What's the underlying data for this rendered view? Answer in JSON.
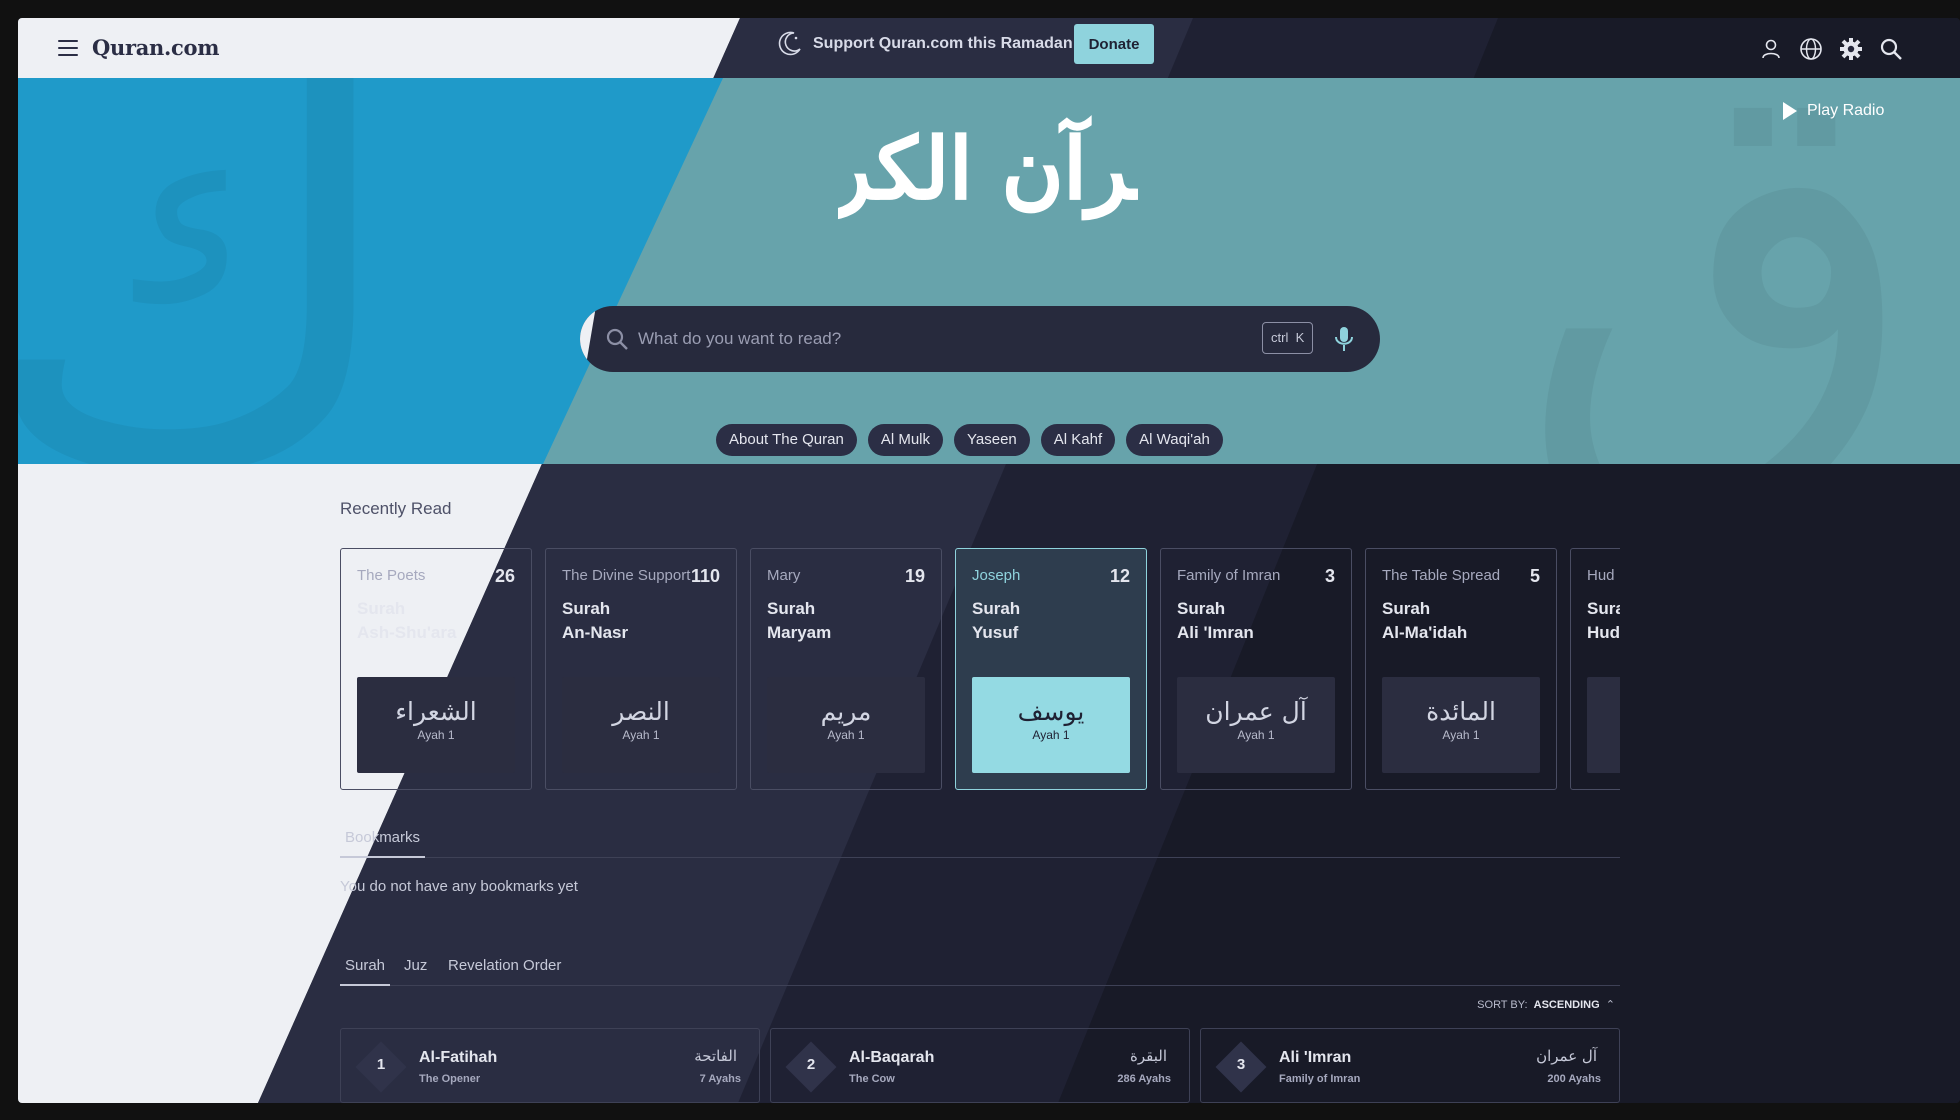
{
  "header": {
    "logo": "Quran.com",
    "support_text": "Support Quran.com this Ramadan",
    "donate_label": "Donate"
  },
  "hero": {
    "play_radio": "Play Radio",
    "calligraphy": "القرآن الكريم",
    "search": {
      "placeholder": "What do you want to read?",
      "shortcut_ctrl": "ctrl",
      "shortcut_key": "K"
    },
    "chips": [
      "About The Quran",
      "Al Mulk",
      "Yaseen",
      "Al Kahf",
      "Al Waqi'ah"
    ]
  },
  "recently_read": {
    "title": "Recently Read",
    "cards": [
      {
        "english": "The Poets",
        "number": "26",
        "surah_line1": "Surah",
        "surah_line2": "Ash-Shu'ara",
        "arabic": "الشعراء",
        "ayah": "Ayah 1"
      },
      {
        "english": "The Divine Support",
        "number": "110",
        "surah_line1": "Surah",
        "surah_line2": "An-Nasr",
        "arabic": "النصر",
        "ayah": "Ayah 1"
      },
      {
        "english": "Mary",
        "number": "19",
        "surah_line1": "Surah",
        "surah_line2": "Maryam",
        "arabic": "مريم",
        "ayah": "Ayah 1"
      },
      {
        "english": "Joseph",
        "number": "12",
        "surah_line1": "Surah",
        "surah_line2": "Yusuf",
        "arabic": "يوسف",
        "ayah": "Ayah 1"
      },
      {
        "english": "Family of Imran",
        "number": "3",
        "surah_line1": "Surah",
        "surah_line2": "Ali 'Imran",
        "arabic": "آل عمران",
        "ayah": "Ayah 1"
      },
      {
        "english": "The Table Spread",
        "number": "5",
        "surah_line1": "Surah",
        "surah_line2": "Al-Ma'idah",
        "arabic": "المائدة",
        "ayah": "Ayah 1"
      },
      {
        "english": "Hud",
        "number": "",
        "surah_line1": "Surah",
        "surah_line2": "Hud",
        "arabic": "",
        "ayah": ""
      }
    ]
  },
  "bookmarks": {
    "tab_label": "Bookmarks",
    "empty_message": "You do not have any bookmarks yet"
  },
  "index_tabs": [
    "Surah",
    "Juz",
    "Revelation Order"
  ],
  "sort": {
    "label": "SORT BY:",
    "value": "ASCENDING"
  },
  "surah_list": [
    {
      "number": "1",
      "name": "Al-Fatihah",
      "translation": "The Opener",
      "arabic": "الفاتحة",
      "ayahs": "7 Ayahs"
    },
    {
      "number": "2",
      "name": "Al-Baqarah",
      "translation": "The Cow",
      "arabic": "البقرة",
      "ayahs": "286 Ayahs"
    },
    {
      "number": "3",
      "name": "Ali 'Imran",
      "translation": "Family of Imran",
      "arabic": "آل عمران",
      "ayahs": "200 Ayahs"
    }
  ],
  "colors": {
    "accent": "#8fd3dd",
    "hero_blue": "#1f9ac9",
    "hero_teal": "#67a3ab",
    "dark_bg": "#1f2133"
  }
}
